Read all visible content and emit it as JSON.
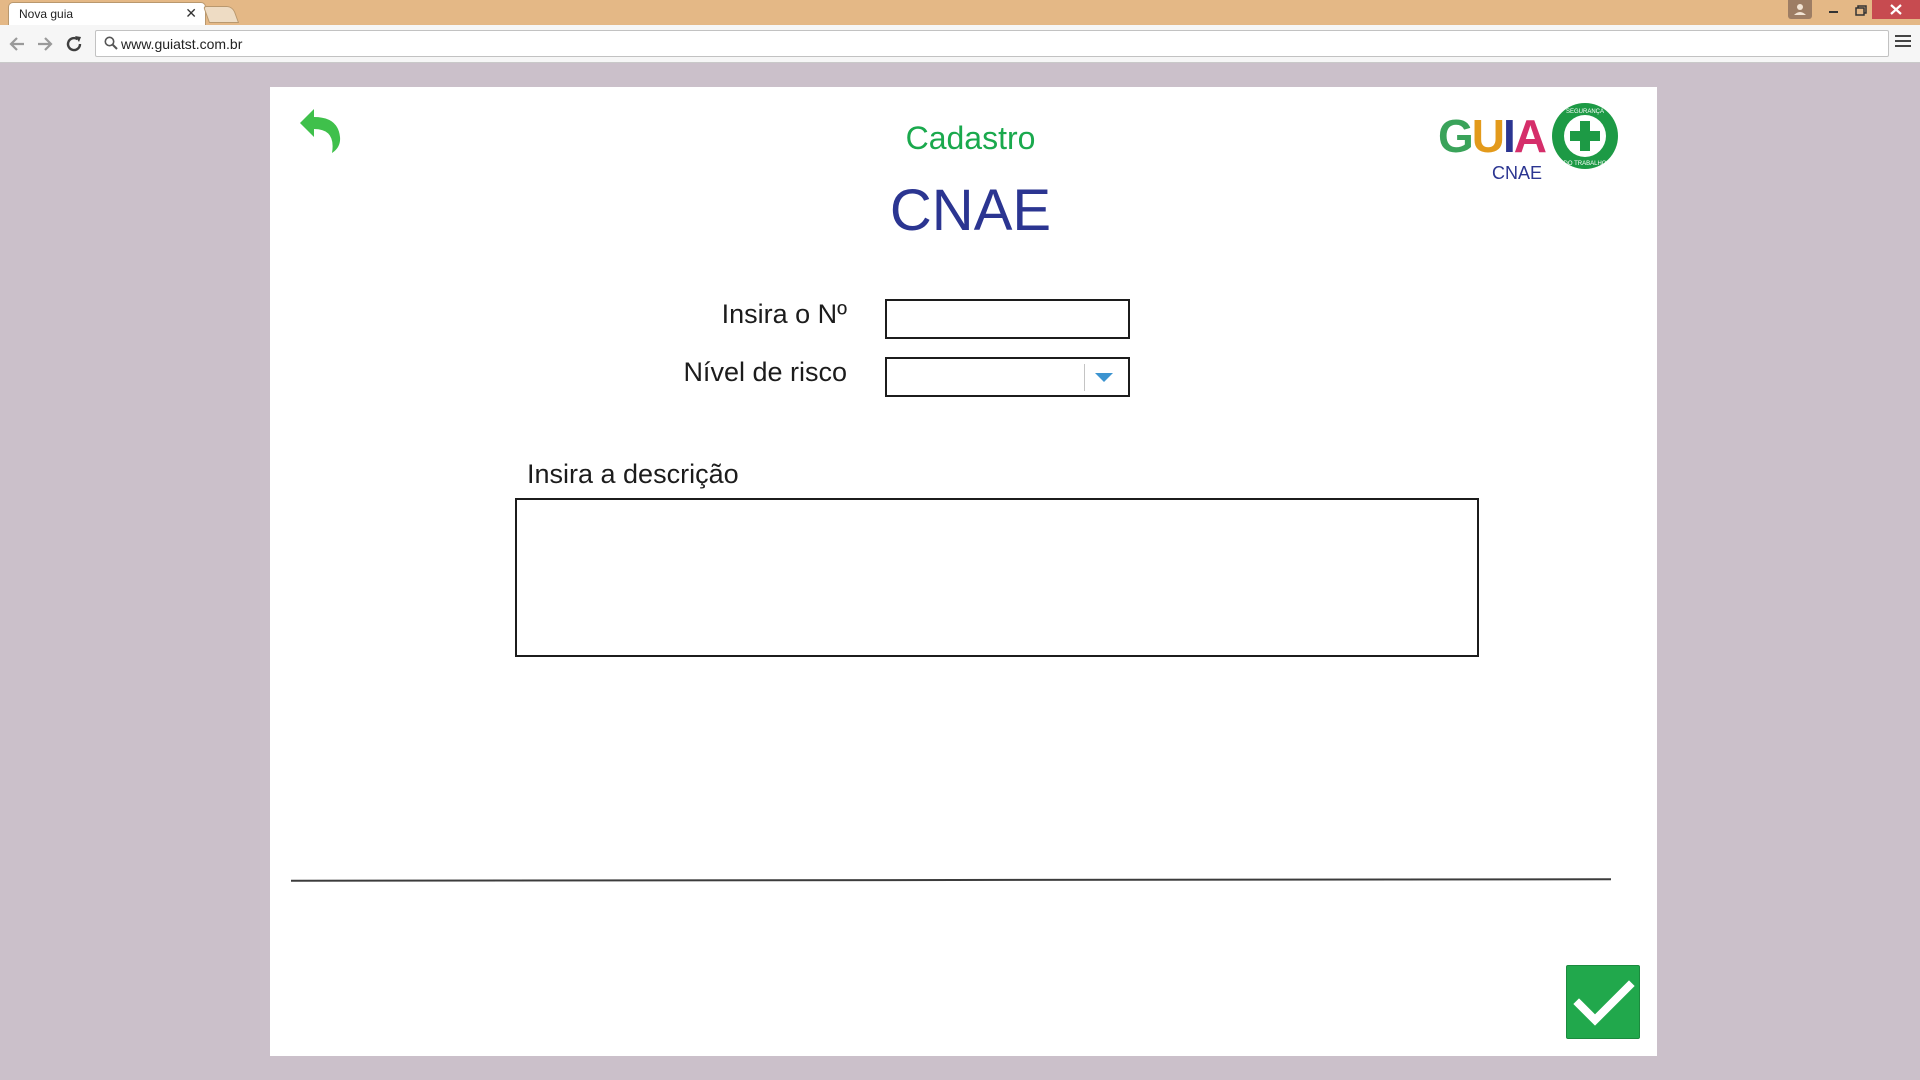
{
  "browser": {
    "tab_title": "Nova guia",
    "tab_close": "✕",
    "url": "www.guiatst.com.br"
  },
  "page": {
    "subtitle": "Cadastro",
    "title": "CNAE",
    "logo": {
      "word_g": "G",
      "word_u": "U",
      "word_i": "I",
      "word_a": "A",
      "sub": "CNAE",
      "badge_top": "SEGURANÇA",
      "badge_bottom": "DO TRABALHO"
    },
    "form": {
      "number_label": "Insira o Nº",
      "number_value": "",
      "risk_label": "Nível de risco",
      "risk_value": "",
      "description_label": "Insira a descrição",
      "description_value": ""
    }
  },
  "colors": {
    "accent_green": "#1aa94d",
    "title_blue": "#2b3591",
    "confirm_green": "#21a84c"
  },
  "icons": {
    "back": "back-arrow-icon",
    "confirm": "checkmark-icon",
    "dropdown": "chevron-down-icon"
  }
}
